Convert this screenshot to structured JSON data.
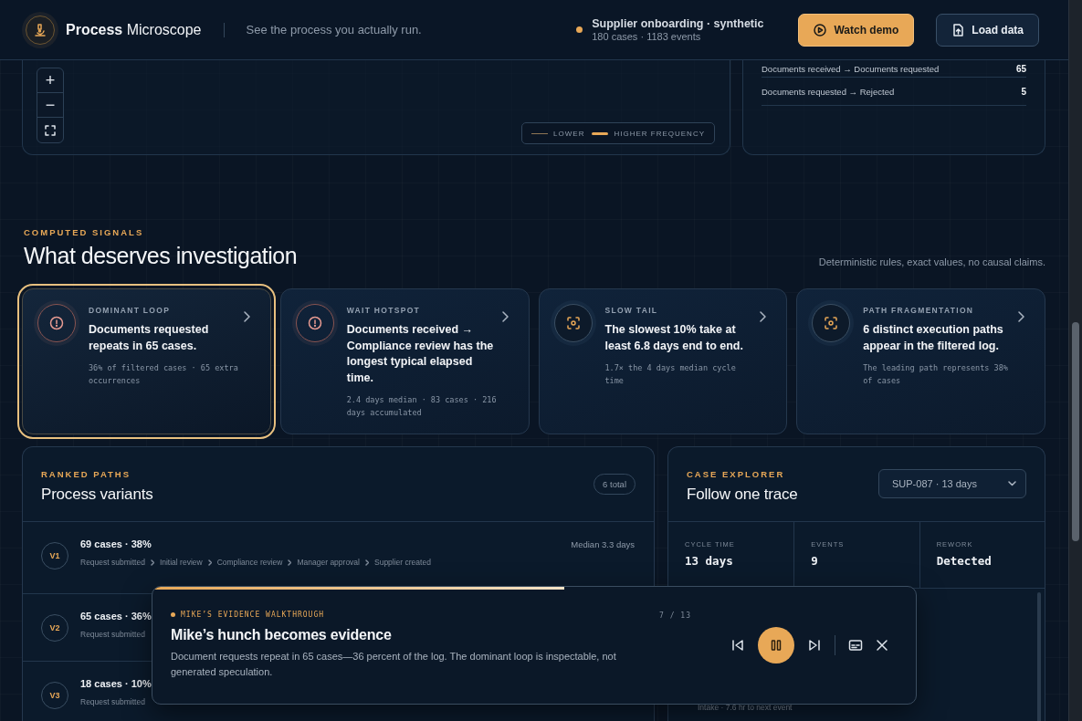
{
  "header": {
    "brand": "**Process** Microscope",
    "tagline": "See the process you actually run.",
    "dataset": {
      "title": "Supplier onboarding · synthetic",
      "subtitle": "180 cases · 1183 events",
      "color": "#e8a857"
    },
    "buttons": [
      {
        "kind": "primary",
        "label": "Watch demo"
      },
      {
        "kind": "secondary",
        "label": "Load data"
      }
    ]
  },
  "map": {
    "zoom_controls": [
      "+",
      "−"
    ],
    "legend": [
      "LOWER",
      "HIGHER FREQUENCY"
    ]
  },
  "transitions": [
    {
      "label": "Documents received → Documents requested",
      "count": "65"
    },
    {
      "label": "Documents requested → Rejected",
      "count": "5"
    }
  ],
  "signals": {
    "eyebrow": "COMPUTED SIGNALS",
    "title": "What deserves investigation",
    "note": "Deterministic rules, exact values, no causal claims.",
    "cards": [
      {
        "kind": "alert",
        "selected": true,
        "label": "DOMINANT LOOP",
        "headline": "Documents requested repeats in 65 cases.",
        "detail": "36% of filtered cases · 65 extra occurrences"
      },
      {
        "kind": "alert",
        "selected": false,
        "label": "WAIT HOTSPOT",
        "headline": "Documents received → Compliance review has the longest typical elapsed time.",
        "detail": "2.4 days median · 83 cases · 216 days accumulated"
      },
      {
        "kind": "focus",
        "selected": false,
        "label": "SLOW TAIL",
        "headline": "The slowest 10% take at least 6.8 days end to end.",
        "detail": "1.7× the 4 days median cycle time"
      },
      {
        "kind": "focus",
        "selected": false,
        "label": "PATH FRAGMENTATION",
        "headline": "6 distinct execution paths appear in the filtered log.",
        "detail": "The leading path represents 38% of cases"
      }
    ]
  },
  "variants": {
    "eyebrow": "RANKED PATHS",
    "title": "Process variants",
    "badge": "6 total",
    "rows": [
      {
        "id": "V1",
        "summary": "69 cases · 38%",
        "median": "Median 3.3 days",
        "steps": [
          "Request submitted",
          "Initial review",
          "Compliance review",
          "Manager approval",
          "Supplier created"
        ]
      },
      {
        "id": "V2",
        "summary": "65 cases · 36%",
        "steps": [
          "Request submitted"
        ]
      },
      {
        "id": "V3",
        "summary": "18 cases · 10%",
        "steps": [
          "Request submitted"
        ]
      }
    ]
  },
  "case_explorer": {
    "eyebrow": "CASE EXPLORER",
    "title": "Follow one trace",
    "case_select": "SUP-087 · 13 days",
    "stats": [
      {
        "label": "CYCLE TIME",
        "value": "13 days"
      },
      {
        "label": "EVENTS",
        "value": "9"
      },
      {
        "label": "REWORK",
        "value": "Detected"
      }
    ],
    "timeline_note": "Intake · 7.6 hr to next event"
  },
  "walkthrough": {
    "eyebrow": "MIKE’S EVIDENCE WALKTHROUGH",
    "step": "7 / 13",
    "level": 0.54,
    "title": "Mike’s hunch becomes evidence",
    "text": "Document requests repeat in 65 cases—36 percent of the log. The dominant loop is inspectable, not generated speculation.",
    "playing": true
  }
}
